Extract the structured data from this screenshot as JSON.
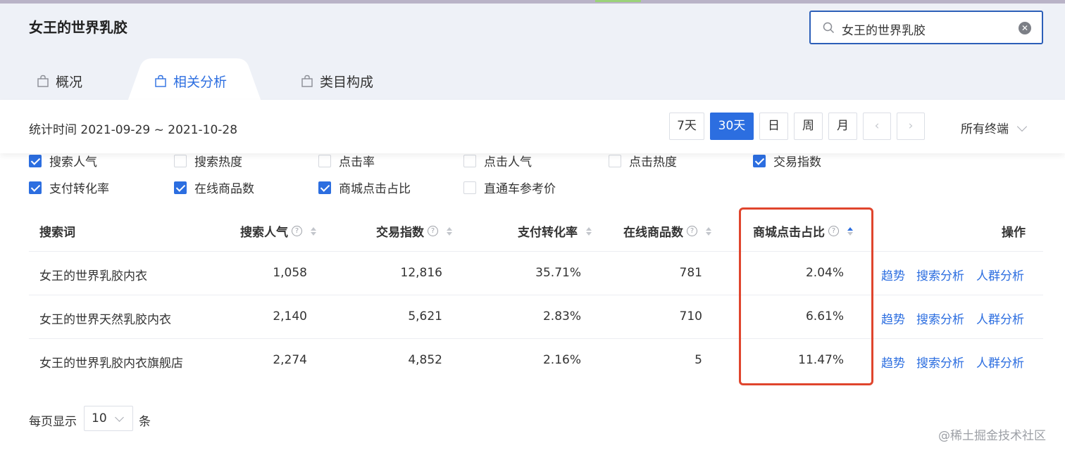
{
  "header": {
    "title": "女王的世界乳胶",
    "search_value": "女王的世界乳胶"
  },
  "tabs": [
    {
      "label": "概况",
      "active": false
    },
    {
      "label": "相关分析",
      "active": true
    },
    {
      "label": "类目构成",
      "active": false
    }
  ],
  "stats": {
    "label": "统计时间 2021-09-29 ~ 2021-10-28",
    "ranges": [
      "7天",
      "30天",
      "日",
      "周",
      "月"
    ],
    "active_range": "30天",
    "prev": "‹",
    "next": "›",
    "terminal": "所有终端"
  },
  "metrics": [
    {
      "label": "搜索人气",
      "checked": true
    },
    {
      "label": "搜索热度",
      "checked": false
    },
    {
      "label": "点击率",
      "checked": false
    },
    {
      "label": "点击人气",
      "checked": false
    },
    {
      "label": "点击热度",
      "checked": false
    },
    {
      "label": "交易指数",
      "checked": true
    },
    {
      "label": "支付转化率",
      "checked": true
    },
    {
      "label": "在线商品数",
      "checked": true
    },
    {
      "label": "商城点击占比",
      "checked": true
    },
    {
      "label": "直通车参考价",
      "checked": false
    }
  ],
  "table": {
    "headers": [
      "搜索词",
      "搜索人气",
      "交易指数",
      "支付转化率",
      "在线商品数",
      "商城点击占比",
      "操作"
    ],
    "rows": [
      [
        "女王的世界乳胶内衣",
        "1,058",
        "12,816",
        "35.71%",
        "781",
        "2.04%"
      ],
      [
        "女王的世界天然乳胶内衣",
        "2,140",
        "5,621",
        "2.83%",
        "710",
        "6.61%"
      ],
      [
        "女王的世界乳胶内衣旗舰店",
        "2,274",
        "4,852",
        "2.16%",
        "5",
        "11.47%"
      ]
    ],
    "actions": [
      "趋势",
      "搜索分析",
      "人群分析"
    ]
  },
  "pager": {
    "prefix": "每页显示",
    "size": "10",
    "suffix": "条"
  },
  "watermark": "@稀土掘金技术社区",
  "colors": {
    "accent": "#2c6ee0",
    "highlight": "#e0452d"
  }
}
